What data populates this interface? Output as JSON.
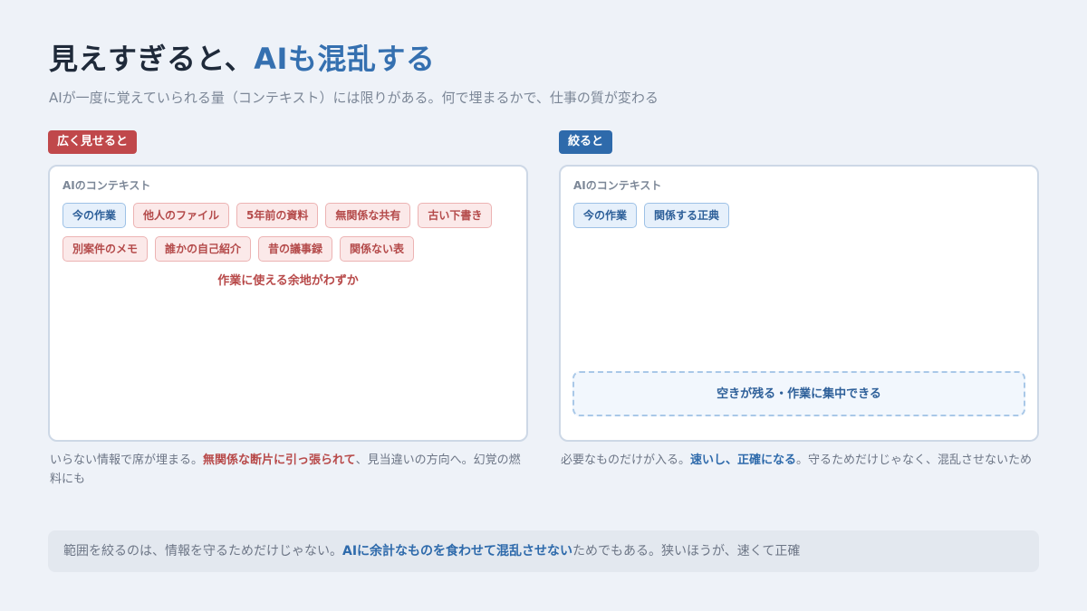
{
  "title": {
    "part1": "見えすぎると、",
    "accent": "AIも混乱する"
  },
  "subtitle": "AIが一度に覚えていられる量（コンテキスト）には限りがある。何で埋まるかで、仕事の質が変わる",
  "left": {
    "badge": "広く見せると",
    "box_label": "AIのコンテキスト",
    "chips": [
      "今の作業",
      "他人のファイル",
      "5年前の資料",
      "無関係な共有",
      "古い下書き",
      "別案件のメモ",
      "誰かの自己紹介",
      "昔の議事録",
      "関係ない表"
    ],
    "warning": "作業に使える余地がわずか",
    "caption": {
      "part1": "いらない情報で席が埋まる。",
      "highlight": "無関係な断片に引っ張られて",
      "part2": "、見当違いの方向へ。幻覚の燃料にも"
    }
  },
  "right": {
    "badge": "絞ると",
    "box_label": "AIのコンテキスト",
    "chips": [
      "今の作業",
      "関係する正典"
    ],
    "free_space": "空きが残る・作業に集中できる",
    "caption": {
      "part1": "必要なものだけが入る。",
      "highlight": "速いし、正確になる",
      "part2": "。守るためだけじゃなく、混乱させないため"
    }
  },
  "footer": {
    "part1": "範囲を絞るのは、情報を守るためだけじゃない。",
    "highlight": "AIに余計なものを食わせて混乱させない",
    "part2": "ためでもある。狭いほうが、速くて正確"
  },
  "colors": {
    "background": "#eef2f8",
    "accent_blue": "#2e6aab",
    "accent_red": "#c0484b"
  }
}
